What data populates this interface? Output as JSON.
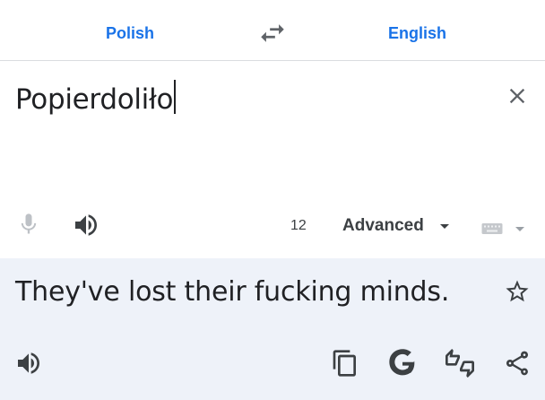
{
  "header": {
    "source_language": "Polish",
    "target_language": "English"
  },
  "source": {
    "text": "Popierdoliło",
    "char_count": "12",
    "mode": "Advanced"
  },
  "result": {
    "text": "They've lost their fucking minds."
  },
  "colors": {
    "accent": "#1a73e8",
    "icon": "#5f6368",
    "result_background": "#eef2f9"
  }
}
